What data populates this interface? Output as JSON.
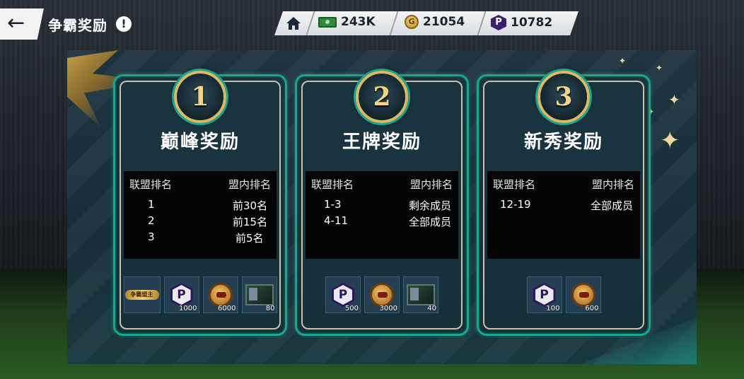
{
  "header": {
    "title": "争霸奖励",
    "info_symbol": "!",
    "back_symbol": "←"
  },
  "currencies": [
    {
      "icon": "cash-icon",
      "value": "243K"
    },
    {
      "icon": "coin-icon",
      "symbol": "G",
      "value": "21054"
    },
    {
      "icon": "p-coin-icon",
      "value": "10782"
    }
  ],
  "cards": [
    {
      "rank": "1",
      "title": "巅峰奖励",
      "col1_header": "联盟排名",
      "col2_header": "盟内排名",
      "rows": [
        {
          "league": "1",
          "member": "前30名"
        },
        {
          "league": "2",
          "member": "前15名"
        },
        {
          "league": "3",
          "member": "前5名"
        }
      ],
      "rewards": [
        {
          "icon": "title-badge-icon",
          "label": "争霸盟主",
          "qty": ""
        },
        {
          "icon": "p-coin-icon",
          "qty": "1000"
        },
        {
          "icon": "medal-icon",
          "qty": "6000"
        },
        {
          "icon": "player-card-icon",
          "qty": "80"
        }
      ]
    },
    {
      "rank": "2",
      "title": "王牌奖励",
      "col1_header": "联盟排名",
      "col2_header": "盟内排名",
      "rows": [
        {
          "league": "1-3",
          "member": "剩余成员"
        },
        {
          "league": "4-11",
          "member": "全部成员"
        }
      ],
      "rewards": [
        {
          "icon": "p-coin-icon",
          "qty": "500"
        },
        {
          "icon": "medal-icon",
          "qty": "3000"
        },
        {
          "icon": "player-card-icon",
          "qty": "40"
        }
      ]
    },
    {
      "rank": "3",
      "title": "新秀奖励",
      "col1_header": "联盟排名",
      "col2_header": "盟内排名",
      "rows": [
        {
          "league": "12-19",
          "member": "全部成员"
        }
      ],
      "rewards": [
        {
          "icon": "p-coin-icon",
          "qty": "100"
        },
        {
          "icon": "medal-icon",
          "qty": "600"
        }
      ]
    }
  ]
}
